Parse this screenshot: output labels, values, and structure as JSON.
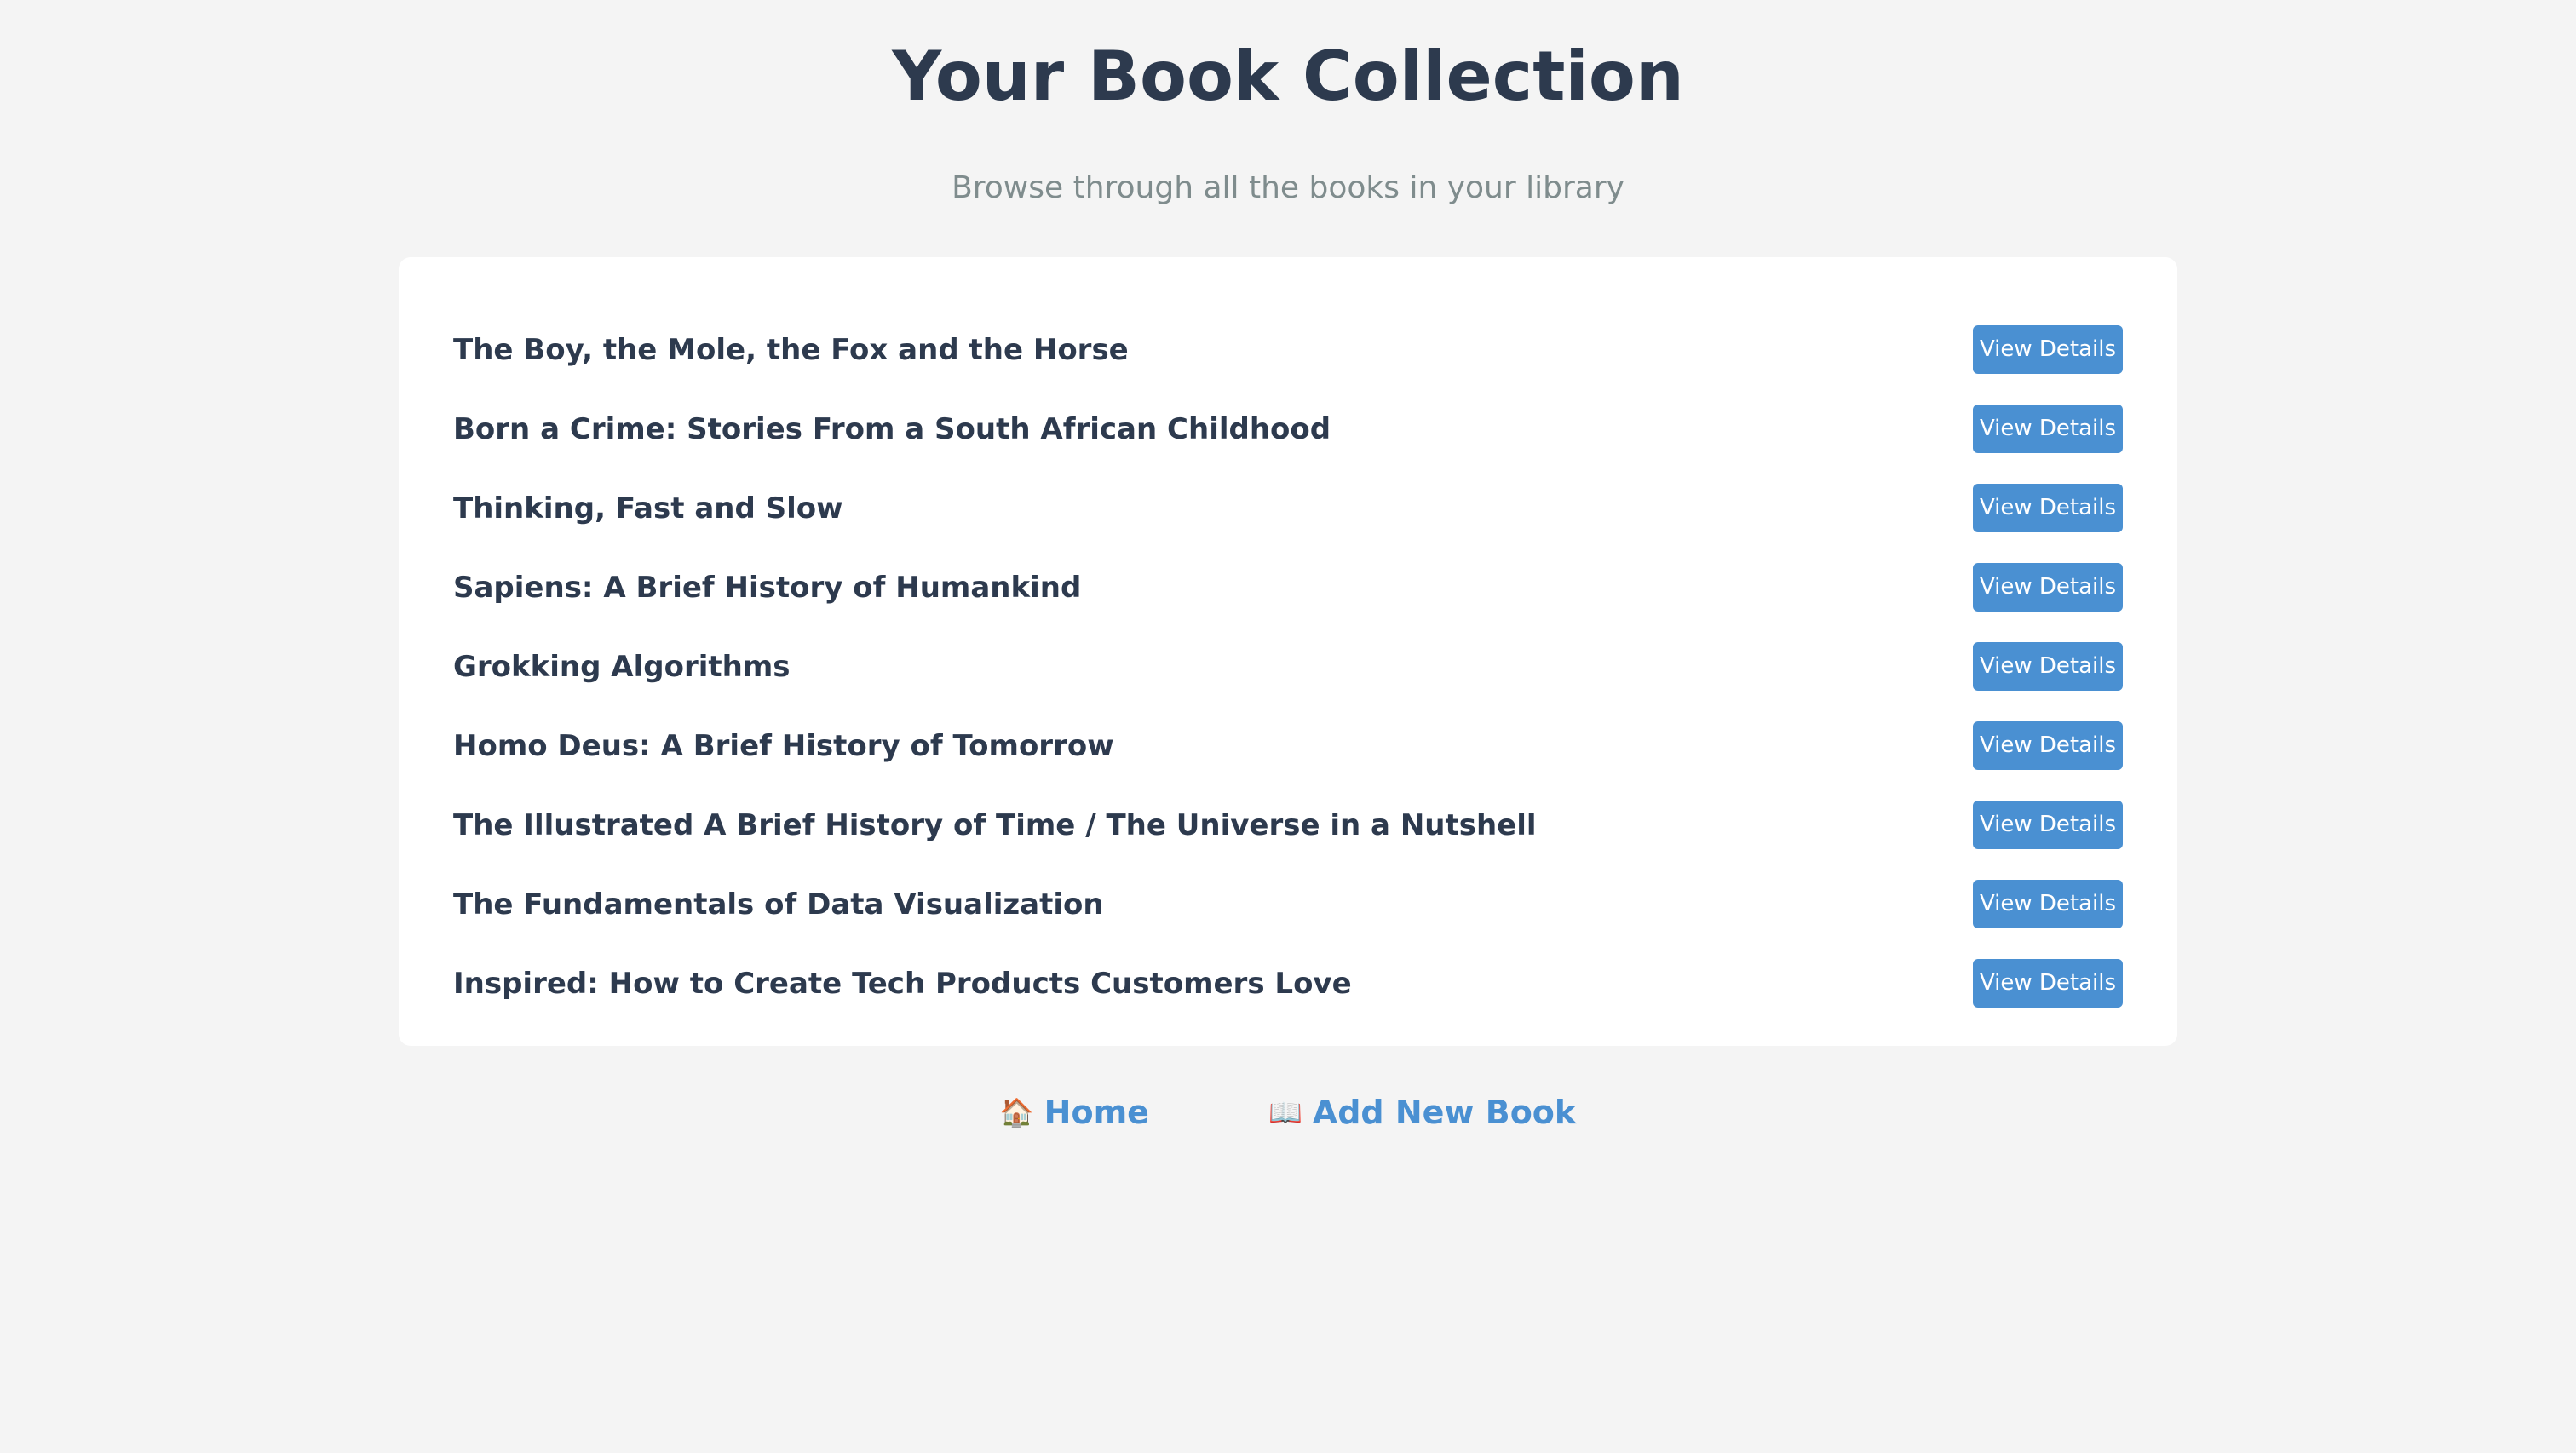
{
  "header": {
    "title": "Your Book Collection",
    "subtitle": "Browse through all the books in your library"
  },
  "books": [
    {
      "title": "The Boy, the Mole, the Fox and the Horse",
      "button_label": "View Details"
    },
    {
      "title": "Born a Crime: Stories From a South African Childhood",
      "button_label": "View Details"
    },
    {
      "title": "Thinking, Fast and Slow",
      "button_label": "View Details"
    },
    {
      "title": "Sapiens: A Brief History of Humankind",
      "button_label": "View Details"
    },
    {
      "title": "Grokking Algorithms",
      "button_label": "View Details"
    },
    {
      "title": "Homo Deus: A Brief History of Tomorrow",
      "button_label": "View Details"
    },
    {
      "title": "The Illustrated A Brief History of Time / The Universe in a Nutshell",
      "button_label": "View Details"
    },
    {
      "title": "The Fundamentals of Data Visualization",
      "button_label": "View Details"
    },
    {
      "title": "Inspired: How to Create Tech Products Customers Love",
      "button_label": "View Details"
    }
  ],
  "footer": {
    "home": {
      "icon": "house-icon",
      "glyph": "🏠",
      "label": "Home"
    },
    "add": {
      "icon": "open-book-icon",
      "glyph": "📖",
      "label": "Add New Book"
    }
  },
  "colors": {
    "background": "#f4f4f4",
    "text": "#2d3a4e",
    "muted": "#7f8c8d",
    "accent": "#4a90d2",
    "card": "#ffffff"
  }
}
